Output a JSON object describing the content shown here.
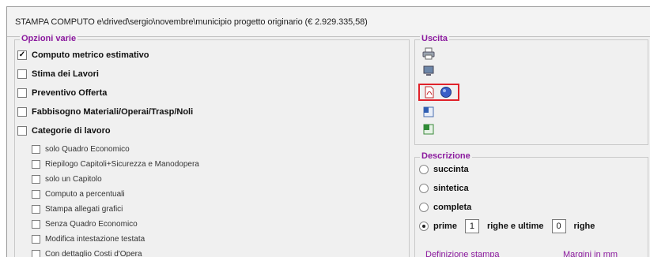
{
  "window": {
    "title": "STAMPA   COMPUTO  e\\drived\\sergio\\novembre\\municipio  progetto originario (€ 2.929.335,58)"
  },
  "options": {
    "title": "Opzioni varie",
    "main": [
      {
        "label": "Computo metrico estimativo",
        "checked": true
      },
      {
        "label": "Stima dei Lavori",
        "checked": false
      },
      {
        "label": "Preventivo Offerta",
        "checked": false
      },
      {
        "label": "Fabbisogno Materiali/Operai/Trasp/Noli",
        "checked": false
      },
      {
        "label": "Categorie di lavoro",
        "checked": false
      }
    ],
    "sub": [
      {
        "label": "solo Quadro Economico",
        "checked": false
      },
      {
        "label": "Riepilogo Capitoli+Sicurezza e Manodopera",
        "checked": false
      },
      {
        "label": "solo un Capitolo",
        "checked": false
      },
      {
        "label": "Computo a percentuali",
        "checked": false
      },
      {
        "label": "Stampa allegati grafici",
        "checked": false
      },
      {
        "label": "Senza Quadro Economico",
        "checked": false
      },
      {
        "label": "Modifica intestazione testata",
        "checked": false
      },
      {
        "label": "Con dettaglio Costi d'Opera",
        "checked": false
      }
    ]
  },
  "output": {
    "title": "Uscita",
    "icons": [
      "printer-icon",
      "monitor-icon",
      "pdf-icon",
      "globe-icon",
      "word-icon",
      "excel-icon"
    ],
    "colors": {
      "highlight": "#e0222a",
      "group_title": "#8b1a9e"
    }
  },
  "description": {
    "title": "Descrizione",
    "options": [
      {
        "label": "succinta",
        "selected": false
      },
      {
        "label": "sintetica",
        "selected": false
      },
      {
        "label": "completa",
        "selected": false
      },
      {
        "label": "prime",
        "selected": true
      }
    ],
    "first_rows": "1",
    "rows_last_label": "righe e ultime",
    "last_rows": "0",
    "rows_label": "righe"
  },
  "footer_cut": {
    "left": "Definizione stampa",
    "right": "Margini in mm"
  }
}
